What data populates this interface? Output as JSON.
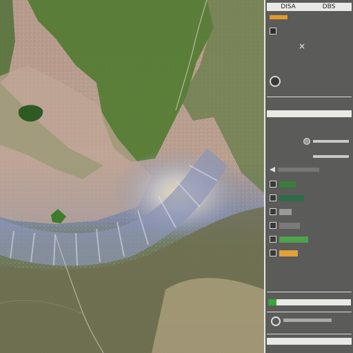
{
  "panel": {
    "header_tabs": [
      "DISA",
      "DBS"
    ],
    "layer_label": "",
    "close_glyph": "×",
    "row_label_a": "",
    "row_label_b": "",
    "section_title": "",
    "legend_heading": [
      "",
      ""
    ],
    "legend_rows": [
      {
        "label": "",
        "color": "#3a7d3a",
        "level": 0.4
      },
      {
        "label": "",
        "color": "#2f6b4a",
        "level": 0.6
      },
      {
        "label": "",
        "color": "#9a9a9a",
        "level": 0.3
      },
      {
        "label": "",
        "color": "#7a7a7a",
        "level": 0.5
      },
      {
        "label": "",
        "color": "#4fa14f",
        "level": 0.7
      },
      {
        "label": "",
        "color": "#e2a23a",
        "level": 0.45
      }
    ],
    "footer_label": "",
    "bottom_tab": ""
  },
  "colors": {
    "panel_bg": "#5b5b59",
    "panel_bar": "#e9e9e6",
    "accent_green": "#39a639",
    "accent_orange": "#e39a2a"
  }
}
